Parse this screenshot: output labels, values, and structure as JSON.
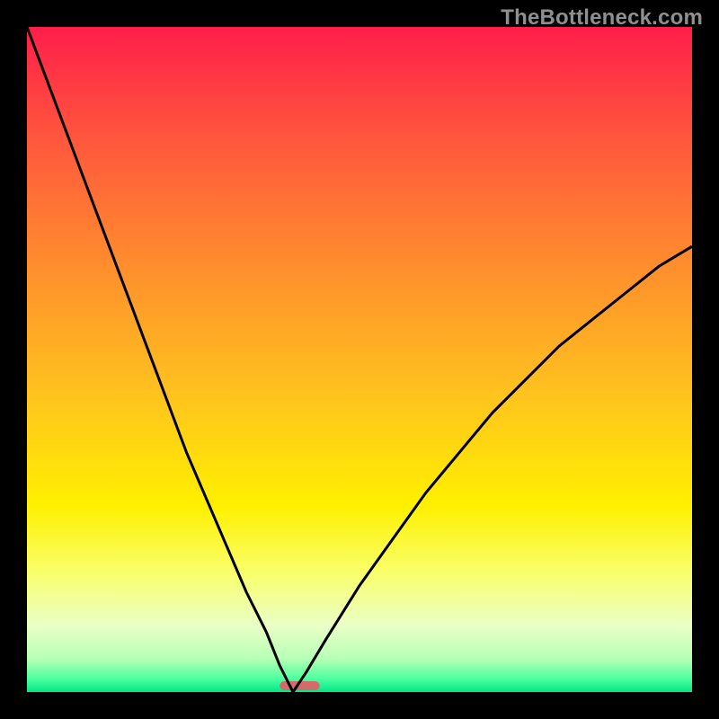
{
  "watermark": "TheBottleneck.com",
  "chart_data": {
    "type": "line",
    "title": "",
    "xlabel": "",
    "ylabel": "",
    "xlim": [
      0,
      100
    ],
    "ylim": [
      0,
      100
    ],
    "grid": false,
    "legend": false,
    "background_gradient_stops": [
      {
        "pos": 0.0,
        "color": "#ff1e4a"
      },
      {
        "pos": 0.18,
        "color": "#ff5a3c"
      },
      {
        "pos": 0.36,
        "color": "#ff8e2d"
      },
      {
        "pos": 0.55,
        "color": "#ffc21e"
      },
      {
        "pos": 0.72,
        "color": "#fff000"
      },
      {
        "pos": 0.82,
        "color": "#f9ff6a"
      },
      {
        "pos": 0.9,
        "color": "#eaffc6"
      },
      {
        "pos": 0.95,
        "color": "#b6ffb6"
      },
      {
        "pos": 0.98,
        "color": "#4dff9e"
      },
      {
        "pos": 1.0,
        "color": "#00e687"
      }
    ],
    "optimum_x": 40,
    "marker": {
      "x_center": 41,
      "width": 6,
      "color": "#d46a6a"
    },
    "series": [
      {
        "name": "bottleneck-curve",
        "x": [
          0,
          3,
          6,
          9,
          12,
          15,
          18,
          21,
          24,
          27,
          30,
          33,
          36,
          38,
          40,
          42,
          45,
          50,
          55,
          60,
          65,
          70,
          75,
          80,
          85,
          90,
          95,
          100
        ],
        "y": [
          100,
          92,
          84,
          76,
          68,
          60,
          52,
          44,
          36,
          29,
          22,
          15,
          9,
          4,
          0,
          3,
          8,
          16,
          23,
          30,
          36,
          42,
          47,
          52,
          56,
          60,
          64,
          67
        ]
      }
    ]
  }
}
